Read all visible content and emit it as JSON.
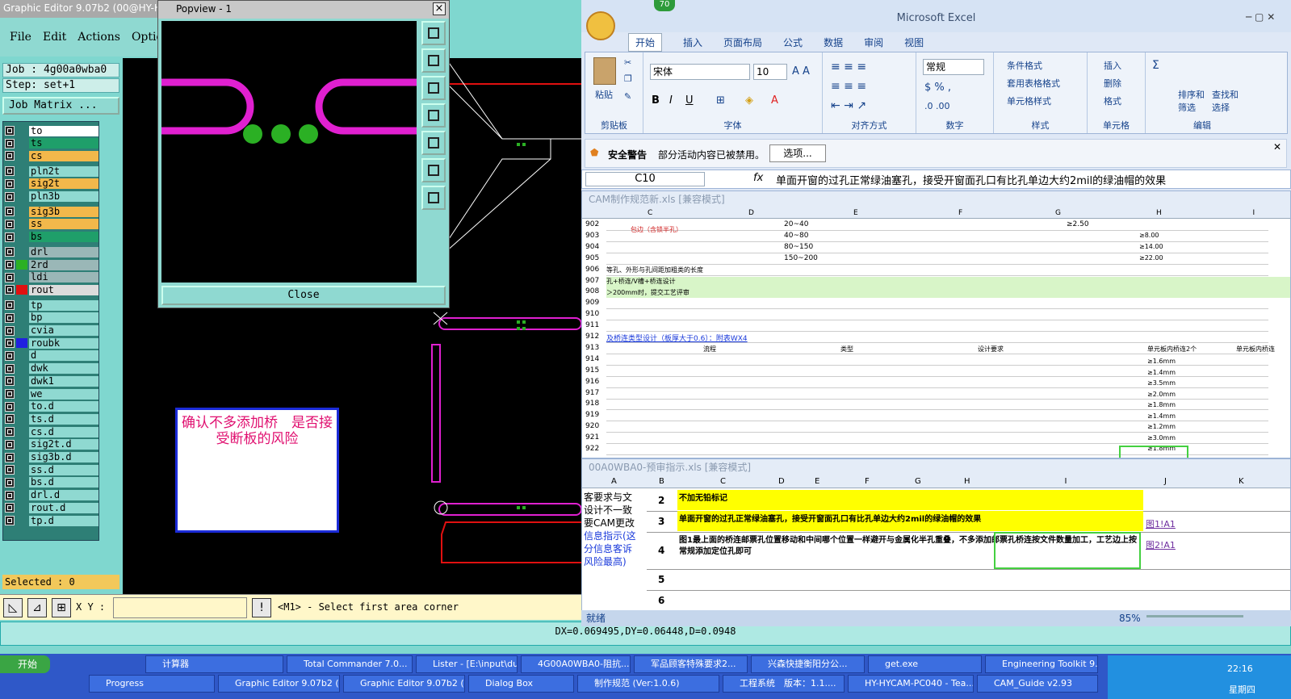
{
  "graphic_editor": {
    "title": "Graphic Editor 9.07b2 (00@HY-H",
    "menu": [
      "File",
      "Edit",
      "Actions",
      "Optio"
    ],
    "job_label": "Job : 4g00a0wba0",
    "step_label": "Step: set+1",
    "job_matrix": "Job Matrix ...",
    "layers": [
      {
        "name": "to",
        "color": "#ffffff",
        "sw": ""
      },
      {
        "name": "ts",
        "color": "#1f9f6a",
        "sw": ""
      },
      {
        "name": "cs",
        "color": "#f2b84b",
        "sw": ""
      },
      {
        "name": "pln2t",
        "color": "#8fd9d1",
        "sw": ""
      },
      {
        "name": "sig2t",
        "color": "#f2b84b",
        "sw": ""
      },
      {
        "name": "pln3b",
        "color": "#8fd9d1",
        "sw": ""
      },
      {
        "name": "sig3b",
        "color": "#f2b84b",
        "sw": ""
      },
      {
        "name": "ss",
        "color": "#f2b84b",
        "sw": ""
      },
      {
        "name": "bs",
        "color": "#1f9f6a",
        "sw": ""
      },
      {
        "name": "drl",
        "color": "#9ab7b7",
        "sw": ""
      },
      {
        "name": "2rd",
        "color": "#9ab7b7",
        "sw": "#2bb024"
      },
      {
        "name": "ldi",
        "color": "#9ab7b7",
        "sw": ""
      },
      {
        "name": "rout",
        "color": "#dcdcdc",
        "sw": "#e01010"
      },
      {
        "name": "tp",
        "color": "#8fd9d1",
        "sw": ""
      },
      {
        "name": "bp",
        "color": "#8fd9d1",
        "sw": ""
      },
      {
        "name": "cvia",
        "color": "#8fd9d1",
        "sw": ""
      },
      {
        "name": "roubk",
        "color": "#8fd9d1",
        "sw": "#2020e0"
      },
      {
        "name": "d",
        "color": "#8fd9d1",
        "sw": ""
      },
      {
        "name": "dwk",
        "color": "#8fd9d1",
        "sw": ""
      },
      {
        "name": "dwk1",
        "color": "#8fd9d1",
        "sw": ""
      },
      {
        "name": "we",
        "color": "#8fd9d1",
        "sw": ""
      },
      {
        "name": "to.d",
        "color": "#8fd9d1",
        "sw": ""
      },
      {
        "name": "ts.d",
        "color": "#8fd9d1",
        "sw": ""
      },
      {
        "name": "cs.d",
        "color": "#8fd9d1",
        "sw": ""
      },
      {
        "name": "sig2t.d",
        "color": "#8fd9d1",
        "sw": ""
      },
      {
        "name": "sig3b.d",
        "color": "#8fd9d1",
        "sw": ""
      },
      {
        "name": "ss.d",
        "color": "#8fd9d1",
        "sw": ""
      },
      {
        "name": "bs.d",
        "color": "#8fd9d1",
        "sw": ""
      },
      {
        "name": "drl.d",
        "color": "#8fd9d1",
        "sw": ""
      },
      {
        "name": "rout.d",
        "color": "#8fd9d1",
        "sw": ""
      },
      {
        "name": "tp.d",
        "color": "#8fd9d1",
        "sw": ""
      }
    ],
    "selected": "Selected : 0",
    "xy_label": "X Y :",
    "prompt": "<M1> - Select first area corner",
    "status": "DX=0.069495,DY=0.06448,D=0.0948",
    "note": "确认不多添加桥　是否接受断板的风险"
  },
  "popview": {
    "title": "Popview - 1",
    "close_label": "Close",
    "tools": [
      "zoom-fit-icon",
      "pan-up-icon",
      "pan-down-icon",
      "pan-left-icon",
      "pan-right-icon",
      "zoom-in-icon",
      "zoom-out-icon"
    ]
  },
  "excel": {
    "title": "Microsoft Excel",
    "badge": "70",
    "tabs": [
      "开始",
      "插入",
      "页面布局",
      "公式",
      "数据",
      "审阅",
      "视图"
    ],
    "font_name": "宋体",
    "font_size": "10",
    "number_format": "常规",
    "groups": [
      "剪贴板",
      "字体",
      "对齐方式",
      "数字",
      "样式",
      "单元格",
      "编辑"
    ],
    "paste": "粘贴",
    "style_items": [
      "条件格式",
      "套用表格格式",
      "单元格样式"
    ],
    "cell_items": [
      "插入",
      "删除",
      "格式"
    ],
    "edit_items": [
      "排序和筛选",
      "查找和选择"
    ],
    "security_title": "安全警告",
    "security_text": "部分活动内容已被禁用。",
    "security_btn": "选项...",
    "name_box": "C10",
    "formula_text": "单面开窗的过孔正常绿油塞孔，接受开窗面孔口有比孔单边大约2mil的绿油帽的效果",
    "wb1_title": "CAM制作规范新.xls  [兼容模式]",
    "wb1_cols": [
      "C",
      "D",
      "E",
      "F",
      "G",
      "H",
      "I"
    ],
    "wb1_rows": [
      "902",
      "903",
      "904",
      "905",
      "906",
      "907",
      "908",
      "909",
      "910",
      "911",
      "912",
      "913",
      "914",
      "915",
      "916",
      "917",
      "918",
      "919",
      "920",
      "921",
      "922"
    ],
    "wb1_d_vals": [
      "20~40",
      "40~80",
      "80~150",
      "150~200"
    ],
    "wb1_f_val": "≥2.50",
    "wb1_h_vals": [
      "≥8.00",
      "≥14.00",
      "≥22.00"
    ],
    "wb1_c_label": "包边（含锁半孔）",
    "wb1_row906": "等孔、外形与孔间距加粗类的长度",
    "wb1_row907": "孔+桥连/V槽+桥连设计",
    "wb1_row908": "＞200mm时，提交工艺评审",
    "wb1_link": "及桥连类型设计（板厚大于0.6）：附表WX4",
    "wb1_hdr": [
      "流程",
      "类型",
      "设计要求",
      "单元板内桥连2个",
      "单元板内桥连"
    ],
    "wb1_h_col": [
      "≥1.6mm",
      "≥1.4mm",
      "≥3.5mm",
      "≥2.0mm",
      "≥1.8mm",
      "≥1.4mm",
      "≥1.2mm",
      "≥3.0mm",
      "≥1.8mm"
    ],
    "wb2_title": "00A0WBA0-预审指示.xls  [兼容模式]",
    "wb2_cols": [
      "A",
      "B",
      "C",
      "D",
      "E",
      "F",
      "G",
      "H",
      "I",
      "J",
      "K"
    ],
    "wb2_a_text": [
      "客要求与文",
      "设计不一致",
      "要CAM更改",
      "信息指示(这",
      "分信息客诉",
      "风险最高)"
    ],
    "wb2_rows": [
      {
        "n": "2",
        "c": "不加无铅标记",
        "j": ""
      },
      {
        "n": "3",
        "c": "单面开窗的过孔正常绿油塞孔，接受开窗面孔口有比孔单边大约2mil的绿油帽的效果",
        "j": "图1!A1"
      },
      {
        "n": "4",
        "c": "图1最上面的桥连邮票孔位置移动和中间哪个位置一样避开与金属化半孔重叠，不多添加邮票孔桥连按文件数量加工，工艺边上按常规添加定位孔即可",
        "j": "图2!A1"
      },
      {
        "n": "5",
        "c": "",
        "j": ""
      },
      {
        "n": "6",
        "c": "",
        "j": ""
      }
    ],
    "status_ready": "就绪",
    "zoom": "85%"
  },
  "taskbar": {
    "start": "开始",
    "row1": [
      "计算器",
      "Total Commander 7.0...",
      "Lister - [E:\\input\\duo...",
      "4G00A0WBA0-阻抗...",
      "军品顾客特殊要求2...",
      "兴森快捷衡阳分公...",
      "get.exe",
      "Engineering Toolkit 9...."
    ],
    "row2": [
      "Progress",
      "Graphic Editor 9.07b2 (0...",
      "Graphic Editor 9.07b2 (0...",
      "Dialog Box",
      "制作规范 (Ver:1.0.6)",
      "工程系统　版本：1.1....",
      "HY-HYCAM-PC040 - Tea...",
      "CAM_Guide v2.93"
    ],
    "time": "22:16",
    "day": "星期四"
  }
}
